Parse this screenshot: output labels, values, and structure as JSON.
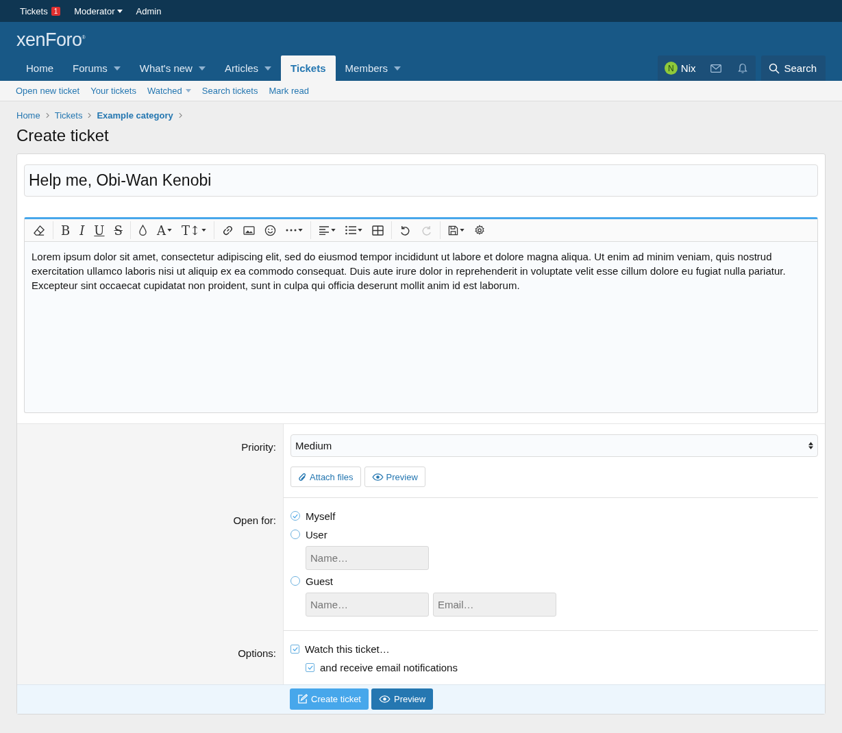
{
  "staff_bar": [
    {
      "label": "Tickets",
      "badge": "1",
      "dropdown": false
    },
    {
      "label": "Moderator",
      "dropdown": true
    },
    {
      "label": "Admin",
      "dropdown": false
    }
  ],
  "logo": "xenForo$^{®}$",
  "nav": [
    {
      "label": "Home",
      "selected": false,
      "dropdown": false
    },
    {
      "label": "Forums",
      "selected": false,
      "dropdown": true
    },
    {
      "label": "What's new",
      "selected": false,
      "dropdown": true
    },
    {
      "label": "Articles",
      "selected": false,
      "dropdown": true
    },
    {
      "label": "Tickets",
      "selected": true,
      "dropdown": false
    },
    {
      "label": "Members",
      "selected": false,
      "dropdown": true
    }
  ],
  "user": {
    "initial": "N",
    "name": "Nix"
  },
  "search_label": "Search",
  "subnav": [
    {
      "label": "Open new ticket",
      "dropdown": false
    },
    {
      "label": "Your tickets",
      "dropdown": false
    },
    {
      "label": "Watched",
      "dropdown": true
    },
    {
      "label": "Search tickets",
      "dropdown": false
    },
    {
      "label": "Mark read",
      "dropdown": false
    }
  ],
  "breadcrumbs": [
    {
      "label": "Home",
      "current": false
    },
    {
      "label": "Tickets",
      "current": false
    },
    {
      "label": "Example category",
      "current": true
    }
  ],
  "page_title": "Create ticket",
  "title_field": {
    "value": "Help me, Obi-Wan Kenobi"
  },
  "toolbar": [
    [
      {
        "kind": "eraser",
        "dropdown": false,
        "disabled": false
      }
    ],
    [
      {
        "kind": "bold",
        "glyph": "B",
        "dropdown": false,
        "disabled": false
      },
      {
        "kind": "italic",
        "glyph": "I",
        "dropdown": false,
        "disabled": false
      },
      {
        "kind": "underline",
        "glyph": "U",
        "dropdown": false,
        "disabled": false
      },
      {
        "kind": "strike",
        "glyph": "S",
        "dropdown": false,
        "disabled": false
      }
    ],
    [
      {
        "kind": "drop",
        "dropdown": false,
        "disabled": false
      },
      {
        "kind": "letter",
        "glyph": "A",
        "dropdown": true,
        "disabled": false
      },
      {
        "kind": "letter",
        "glyph": "T↕",
        "dropdown": true,
        "disabled": false
      }
    ],
    [
      {
        "kind": "link",
        "dropdown": false,
        "disabled": false
      },
      {
        "kind": "image",
        "dropdown": false,
        "disabled": false
      },
      {
        "kind": "smile",
        "dropdown": false,
        "disabled": false
      },
      {
        "kind": "more",
        "dropdown": true,
        "disabled": false
      }
    ],
    [
      {
        "kind": "align",
        "dropdown": true,
        "disabled": false
      },
      {
        "kind": "list",
        "dropdown": true,
        "disabled": false
      },
      {
        "kind": "table",
        "dropdown": false,
        "disabled": false
      }
    ],
    [
      {
        "kind": "undo",
        "dropdown": false,
        "disabled": false
      },
      {
        "kind": "redo",
        "dropdown": false,
        "disabled": true
      }
    ],
    [
      {
        "kind": "save",
        "dropdown": true,
        "disabled": false
      },
      {
        "kind": "gear",
        "dropdown": false,
        "disabled": false
      }
    ]
  ],
  "editor_text": "Lorem ipsum dolor sit amet, consectetur adipiscing elit, sed do eiusmod tempor incididunt ut labore et dolore magna aliqua. Ut enim ad minim veniam, quis nostrud exercitation ullamco laboris nisi ut aliquip ex ea commodo consequat. Duis aute irure dolor in reprehenderit in voluptate velit esse cillum dolore eu fugiat nulla pariatur. Excepteur sint occaecat cupidatat non proident, sunt in culpa qui officia deserunt mollit anim id est laborum.",
  "priority": {
    "label": "Priority:",
    "value": "Medium"
  },
  "attach_buttons": [
    {
      "kind": "attach",
      "label": "Attach files"
    },
    {
      "kind": "preview",
      "label": "Preview"
    }
  ],
  "open_for": {
    "label": "Open for:",
    "options": [
      {
        "label": "Myself",
        "selected": true
      },
      {
        "label": "User",
        "selected": false,
        "fields": [
          {
            "placeholder": "Name…"
          }
        ]
      },
      {
        "label": "Guest",
        "selected": false,
        "fields": [
          {
            "placeholder": "Name…"
          },
          {
            "placeholder": "Email…"
          }
        ]
      }
    ]
  },
  "options": {
    "label": "Options:",
    "checkboxes": [
      {
        "label": "Watch this ticket…",
        "checked": true,
        "children": [
          {
            "label": "and receive email notifications",
            "checked": true
          }
        ]
      }
    ]
  },
  "footer_buttons": [
    {
      "kind": "create",
      "label": "Create ticket"
    },
    {
      "kind": "preview",
      "label": "Preview"
    }
  ]
}
